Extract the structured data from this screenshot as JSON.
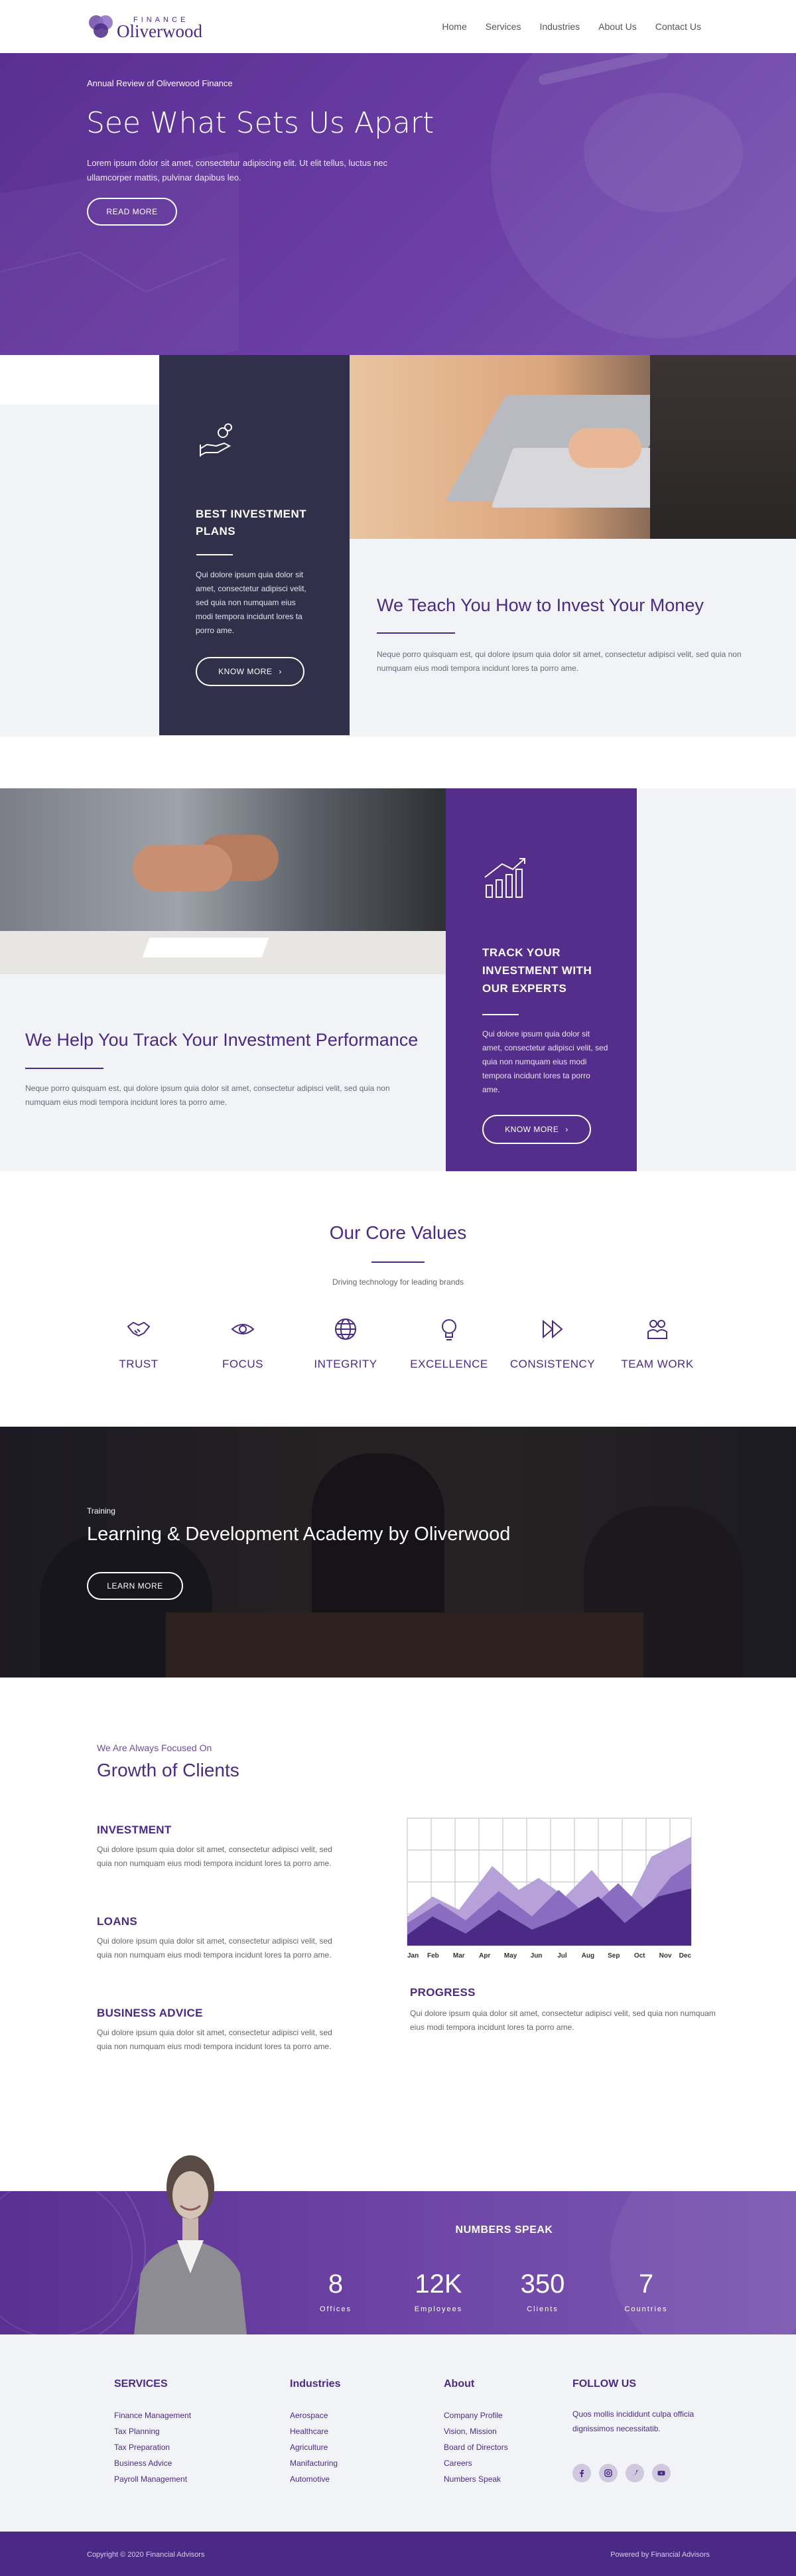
{
  "header": {
    "logo_small": "FINANCE",
    "logo_text": "Oliverwood",
    "nav": [
      "Home",
      "Services",
      "Industries",
      "About Us",
      "Contact Us"
    ]
  },
  "hero": {
    "eyebrow": "Annual Review of Oliverwood Finance",
    "title": "See What Sets Us Apart",
    "text": "Lorem ipsum dolor sit amet, consectetur adipiscing elit. Ut elit tellus, luctus nec ullamcorper mattis, pulvinar dapibus leo.",
    "button": "READ MORE"
  },
  "invest": {
    "card_title": "BEST INVESTMENT PLANS",
    "card_text": "Qui dolore ipsum quia dolor sit amet, consectetur adipisci velit, sed quia non numquam eius modi tempora incidunt lores ta porro ame.",
    "card_button": "KNOW MORE",
    "title": "We Teach You How to Invest Your Money",
    "text": "Neque porro quisquam est, qui dolore ipsum quia dolor sit amet, consectetur adipisci velit, sed quia non numquam eius modi tempora incidunt lores ta porro ame."
  },
  "track": {
    "card_title": "TRACK YOUR INVESTMENT WITH OUR EXPERTS",
    "card_text": "Qui dolore ipsum quia dolor sit amet, consectetur adipisci velit, sed quia non numquam eius modi tempora incidunt lores ta porro ame.",
    "card_button": "KNOW MORE",
    "title": "We Help You Track Your Investment Performance",
    "text": "Neque porro quisquam est, qui dolore ipsum quia dolor sit amet, consectetur adipisci velit, sed quia non numquam eius modi tempora incidunt lores ta porro ame."
  },
  "core_values": {
    "title": "Our Core Values",
    "subtitle": "Driving technology for leading brands",
    "items": [
      {
        "label": "TRUST",
        "icon": "handshake-icon"
      },
      {
        "label": "FOCUS",
        "icon": "eye-icon"
      },
      {
        "label": "INTEGRITY",
        "icon": "globe-icon"
      },
      {
        "label": "EXCELLENCE",
        "icon": "lightbulb-icon"
      },
      {
        "label": "CONSISTENCY",
        "icon": "fast-forward-icon"
      },
      {
        "label": "TEAM WORK",
        "icon": "team-icon"
      }
    ]
  },
  "training": {
    "eyebrow": "Training",
    "title": "Learning & Development Academy by Oliverwood",
    "button": "LEARN MORE"
  },
  "growth": {
    "eyebrow": "We Are Always Focused On",
    "title": "Growth of Clients",
    "items": [
      {
        "head": "INVESTMENT",
        "text": "Qui dolore ipsum quia dolor sit amet, consectetur adipisci velit, sed quia non numquam eius modi tempora incidunt lores ta porro ame."
      },
      {
        "head": "LOANS",
        "text": "Qui dolore ipsum quia dolor sit amet, consectetur adipisci velit, sed quia non numquam eius modi tempora incidunt lores ta porro ame."
      },
      {
        "head": "BUSINESS ADVICE",
        "text": "Qui dolore ipsum quia dolor sit amet, consectetur adipisci velit, sed quia non numquam eius modi tempora incidunt lores ta porro ame."
      }
    ],
    "progress_head": "PROGRESS",
    "progress_text": "Qui dolore ipsum quia dolor sit amet, consectetur adipisci velit, sed quia non numquam eius modi tempora incidunt lores ta porro ame.",
    "chart_months": [
      "Jan",
      "Feb",
      "Mar",
      "Apr",
      "May",
      "Jun",
      "Jul",
      "Aug",
      "Sep",
      "Oct",
      "Nov",
      "Dec"
    ]
  },
  "numbers": {
    "title": "NUMBERS SPEAK",
    "items": [
      {
        "value": "8",
        "label": "Offices"
      },
      {
        "value": "12K",
        "label": "Employees"
      },
      {
        "value": "350",
        "label": "Clients"
      },
      {
        "value": "7",
        "label": "Countries"
      }
    ]
  },
  "footer": {
    "services_head": "SERVICES",
    "services": [
      "Finance Management",
      "Tax Planning",
      "Tax Preparation",
      "Business Advice",
      "Payroll Management"
    ],
    "industries_head": "Industries",
    "industries": [
      "Aerospace",
      "Healthcare",
      "Agriculture",
      "Manifacturing",
      "Automotive"
    ],
    "about_head": "About",
    "about": [
      "Company Profile",
      "Vision, Mission",
      "Board of Directors",
      "Careers",
      "Numbers Speak"
    ],
    "follow_head": "FOLLOW US",
    "follow_text": "Quos mollis incididunt culpa officia dignissimos necessitatib.",
    "socials": [
      "facebook-icon",
      "instagram-icon",
      "twitter-icon",
      "youtube-icon"
    ],
    "copyright": "Copyright © 2020 Financial Advisors",
    "powered": "Powered by Financial Advisors"
  },
  "colors": {
    "brand": "#4b2a86",
    "dark_card": "#31304a",
    "light_bg": "#f1f3f6"
  }
}
